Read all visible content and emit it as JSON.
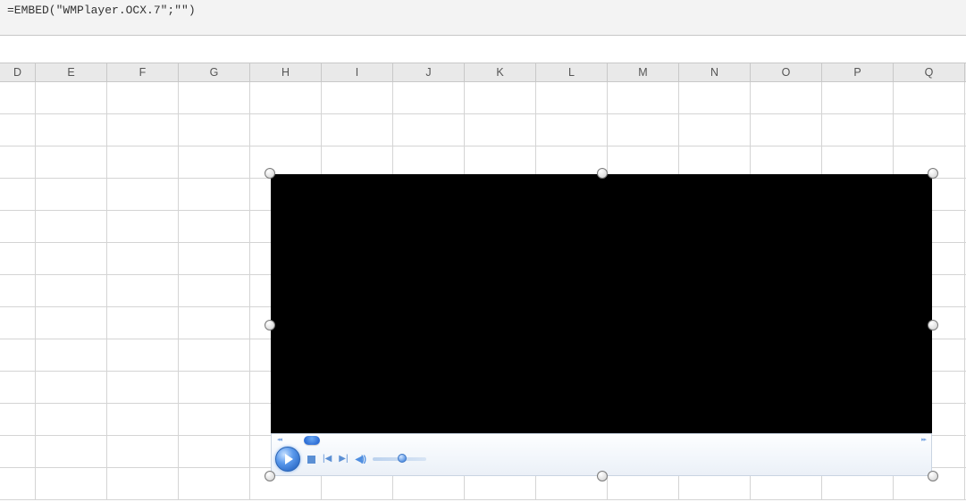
{
  "formula_bar": {
    "value": "=EMBED(\"WMPlayer.OCX.7\";\"\")"
  },
  "columns": [
    "D",
    "E",
    "F",
    "G",
    "H",
    "I",
    "J",
    "K",
    "L",
    "M",
    "N",
    "O",
    "P",
    "Q"
  ],
  "icons": {
    "skip_back_small": "◂◂",
    "skip_fwd_small": "▸▸",
    "prev": "|◀",
    "next": "▶|",
    "speaker": "◀))"
  }
}
